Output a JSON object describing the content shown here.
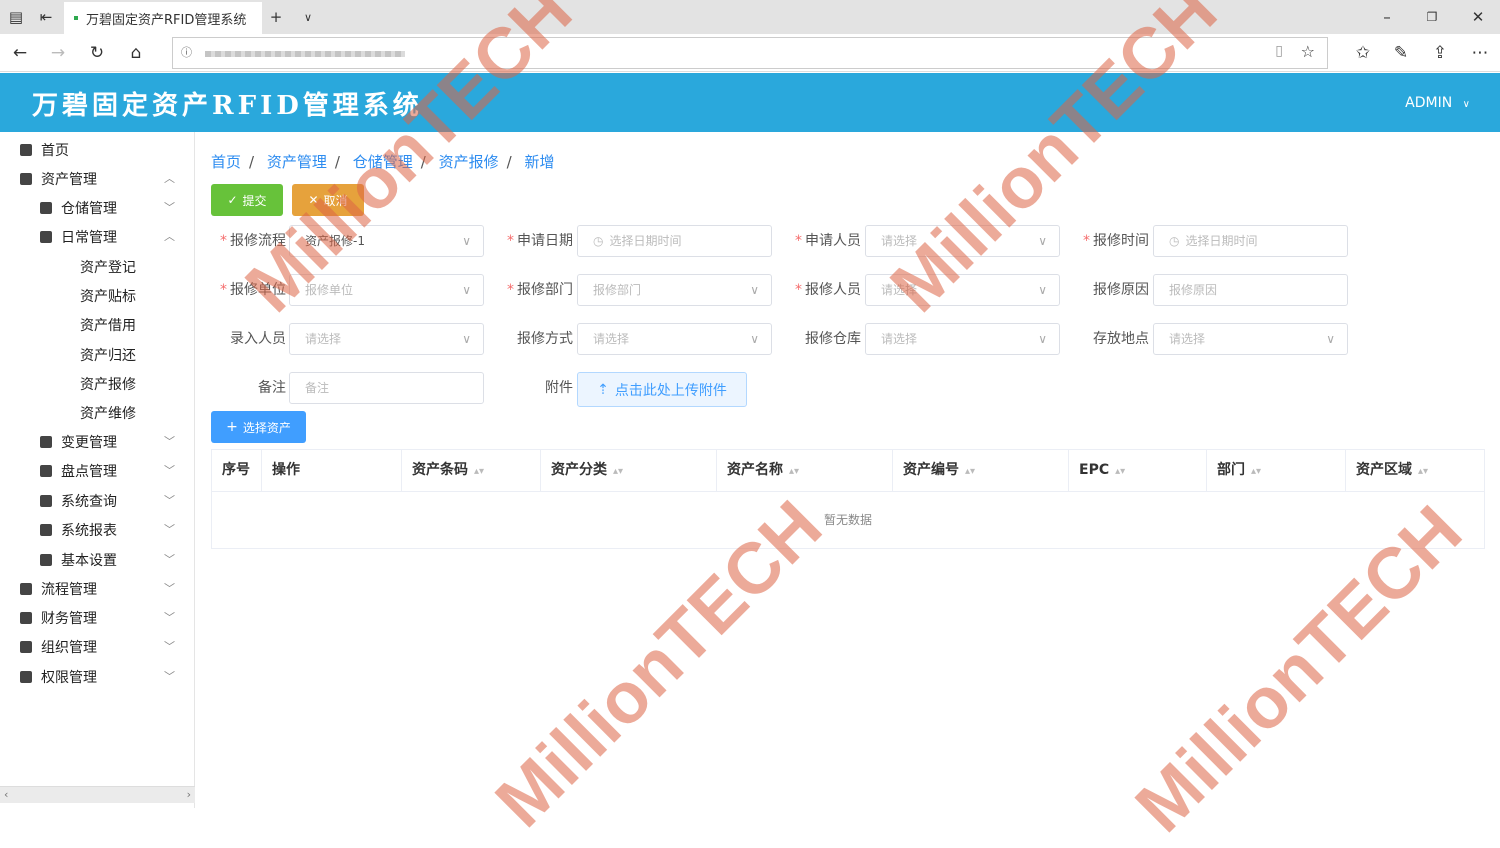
{
  "browser": {
    "tab_title": "万碧固定资产RFID管理系统"
  },
  "app": {
    "title": "万碧固定资产RFID管理系统",
    "user": "ADMIN"
  },
  "sidebar": {
    "items": [
      {
        "label": "首页",
        "level": 0
      },
      {
        "label": "资产管理",
        "level": 0
      },
      {
        "label": "仓储管理",
        "level": 1
      },
      {
        "label": "日常管理",
        "level": 1
      },
      {
        "label": "资产登记",
        "level": 2
      },
      {
        "label": "资产贴标",
        "level": 2
      },
      {
        "label": "资产借用",
        "level": 2
      },
      {
        "label": "资产归还",
        "level": 2
      },
      {
        "label": "资产报修",
        "level": 2
      },
      {
        "label": "资产维修",
        "level": 2
      },
      {
        "label": "变更管理",
        "level": 1
      },
      {
        "label": "盘点管理",
        "level": 1
      },
      {
        "label": "系统查询",
        "level": 1
      },
      {
        "label": "系统报表",
        "level": 1
      },
      {
        "label": "基本设置",
        "level": 1
      },
      {
        "label": "流程管理",
        "level": 0
      },
      {
        "label": "财务管理",
        "level": 0
      },
      {
        "label": "组织管理",
        "level": 0
      },
      {
        "label": "权限管理",
        "level": 0
      }
    ]
  },
  "breadcrumb": [
    "首页",
    "资产管理",
    "仓储管理",
    "资产报修",
    "新增"
  ],
  "buttons": {
    "submit": "提交",
    "cancel": "取消",
    "select_assets": "选择资产",
    "upload": "点击此处上传附件"
  },
  "form": {
    "repair_flow": {
      "label": "报修流程",
      "value": "资产报修-1"
    },
    "apply_date": {
      "label": "申请日期",
      "placeholder": "选择日期时间"
    },
    "applicant": {
      "label": "申请人员",
      "placeholder": "请选择"
    },
    "repair_time": {
      "label": "报修时间",
      "placeholder": "选择日期时间"
    },
    "repair_unit": {
      "label": "报修单位",
      "placeholder": "报修单位"
    },
    "repair_dept": {
      "label": "报修部门",
      "placeholder": "报修部门"
    },
    "repair_person": {
      "label": "报修人员",
      "placeholder": "请选择"
    },
    "repair_reason": {
      "label": "报修原因",
      "placeholder": "报修原因"
    },
    "entry_person": {
      "label": "录入人员",
      "placeholder": "请选择"
    },
    "repair_method": {
      "label": "报修方式",
      "placeholder": "请选择"
    },
    "repair_warehouse": {
      "label": "报修仓库",
      "placeholder": "请选择"
    },
    "storage_location": {
      "label": "存放地点",
      "placeholder": "请选择"
    },
    "remark": {
      "label": "备注",
      "placeholder": "备注"
    },
    "attachment": {
      "label": "附件"
    }
  },
  "table": {
    "columns": [
      "序号",
      "操作",
      "资产条码",
      "资产分类",
      "资产名称",
      "资产编号",
      "EPC",
      "部门",
      "资产区域"
    ],
    "empty_text": "暂无数据"
  },
  "watermark": "MillionTECH"
}
